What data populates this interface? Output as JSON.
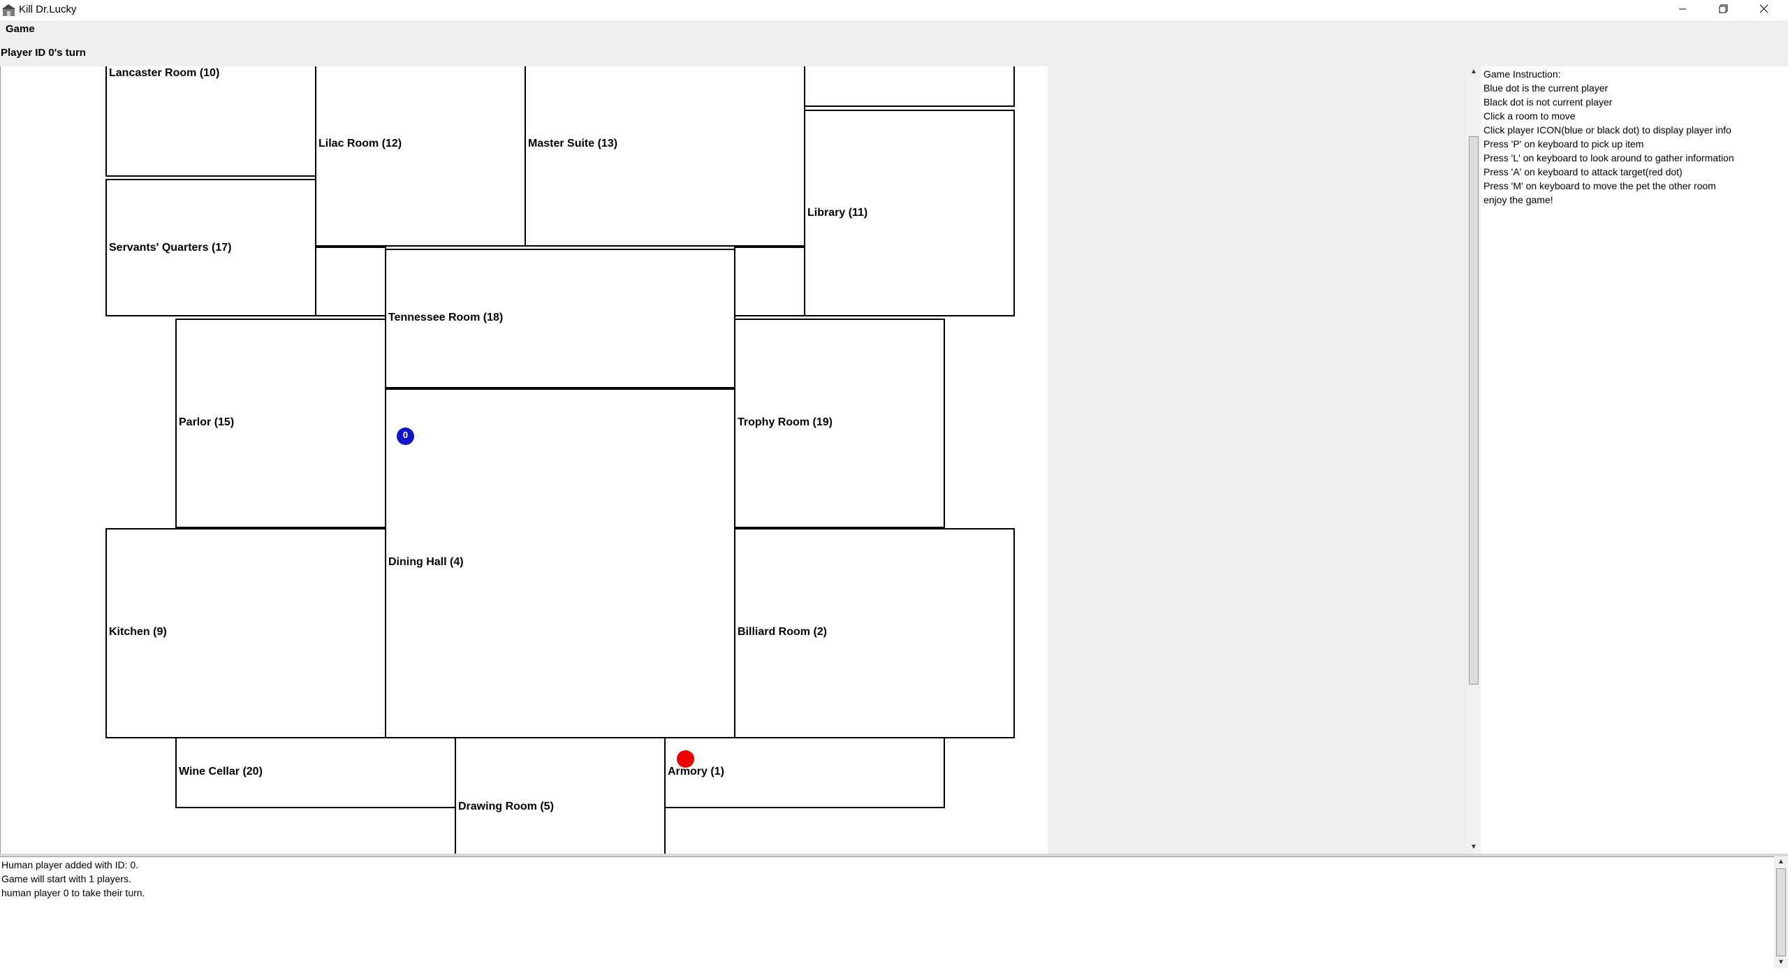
{
  "window": {
    "title": "Kill Dr.Lucky",
    "icons": [
      "app-icon",
      "minimize-icon",
      "restore-icon",
      "close-icon"
    ]
  },
  "menu": {
    "items": [
      "Game"
    ]
  },
  "status": {
    "turn": "Player ID 0's turn"
  },
  "map": {
    "rooms": [
      {
        "id": 10,
        "label": "Lancaster Room (10)"
      },
      {
        "id": 12,
        "label": "Lilac Room (12)"
      },
      {
        "id": 13,
        "label": "Master Suite (13)"
      },
      {
        "id": 11,
        "label": "Library (11)"
      },
      {
        "id": 17,
        "label": "Servants' Quarters (17)"
      },
      {
        "id": 18,
        "label": "Tennessee Room (18)"
      },
      {
        "id": 15,
        "label": "Parlor (15)"
      },
      {
        "id": 19,
        "label": "Trophy Room (19)"
      },
      {
        "id": 4,
        "label": "Dining Hall (4)"
      },
      {
        "id": 9,
        "label": "Kitchen (9)"
      },
      {
        "id": 2,
        "label": "Billiard Room (2)"
      },
      {
        "id": 20,
        "label": "Wine Cellar (20)"
      },
      {
        "id": 5,
        "label": "Drawing Room (5)"
      },
      {
        "id": 1,
        "label": "Armory (1)"
      }
    ],
    "player_marker": {
      "label": "0",
      "color": "#1515c8",
      "room": "Dining Hall (4)"
    },
    "target_marker": {
      "color": "#ee0000",
      "room": "Armory (1)"
    }
  },
  "instructions": {
    "lines": [
      "Game Instruction:",
      "Blue dot is the current player",
      "Black dot is not current player",
      "Click a room to move",
      "Click player ICON(blue or black dot) to display player info",
      "Press 'P' on keyboard to pick up item",
      "Press 'L' on keyboard to look around to gather information",
      "Press 'A' on keyboard to attack target(red dot)",
      "Press 'M' on keyboard to move the pet the other room",
      "enjoy the game!"
    ]
  },
  "log": {
    "lines": [
      "Human player added with ID: 0.",
      "Game will start with 1 players.",
      "human player 0 to take their turn."
    ]
  }
}
